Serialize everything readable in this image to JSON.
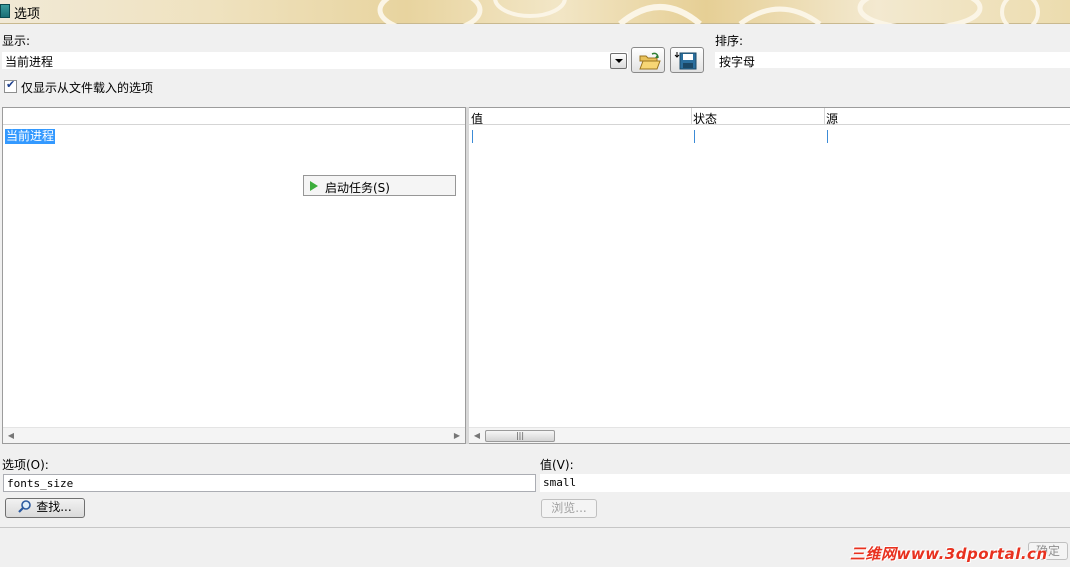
{
  "window": {
    "title": "选项"
  },
  "display": {
    "label": "显示:",
    "selected": "当前进程"
  },
  "sort": {
    "label": "排序:",
    "value": "按字母"
  },
  "filter": {
    "checkbox_label": "仅显示从文件载入的选项",
    "checked": true
  },
  "tree": {
    "items": [
      {
        "label": "当前进程",
        "selected": true
      }
    ]
  },
  "context_item": {
    "label": "启动任务(S)",
    "icon": "play-icon"
  },
  "list": {
    "columns": [
      "值",
      "状态",
      "源"
    ]
  },
  "option": {
    "label": "选项(O):",
    "value": "fonts_size"
  },
  "value": {
    "label": "值(V):",
    "value": "small"
  },
  "buttons": {
    "find": "查找...",
    "browse": "浏览...",
    "ok": "确定"
  },
  "icons": {
    "open": "folder-open-icon",
    "save": "save-disk-icon",
    "find": "magnifier-icon"
  },
  "watermark": "三维网www.3dportal.cn"
}
